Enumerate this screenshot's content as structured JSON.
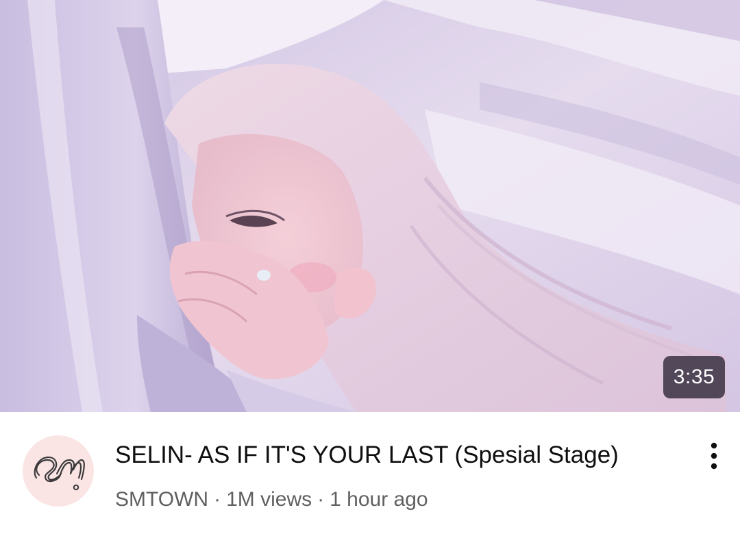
{
  "video": {
    "duration": "3:35",
    "title": "SELIN- AS IF IT'S YOUR LAST (Spesial Stage)",
    "channel": "SMTOWN",
    "separator": "·",
    "views": "1M views",
    "published": "1 hour ago",
    "avatar_icon": "sm-logo-icon",
    "more_icon": "more-vert-icon"
  },
  "colors": {
    "avatar_bg": "#fbe4e4",
    "title": "#0f0f0f",
    "meta": "#606060",
    "badge_bg": "#2a2434"
  }
}
